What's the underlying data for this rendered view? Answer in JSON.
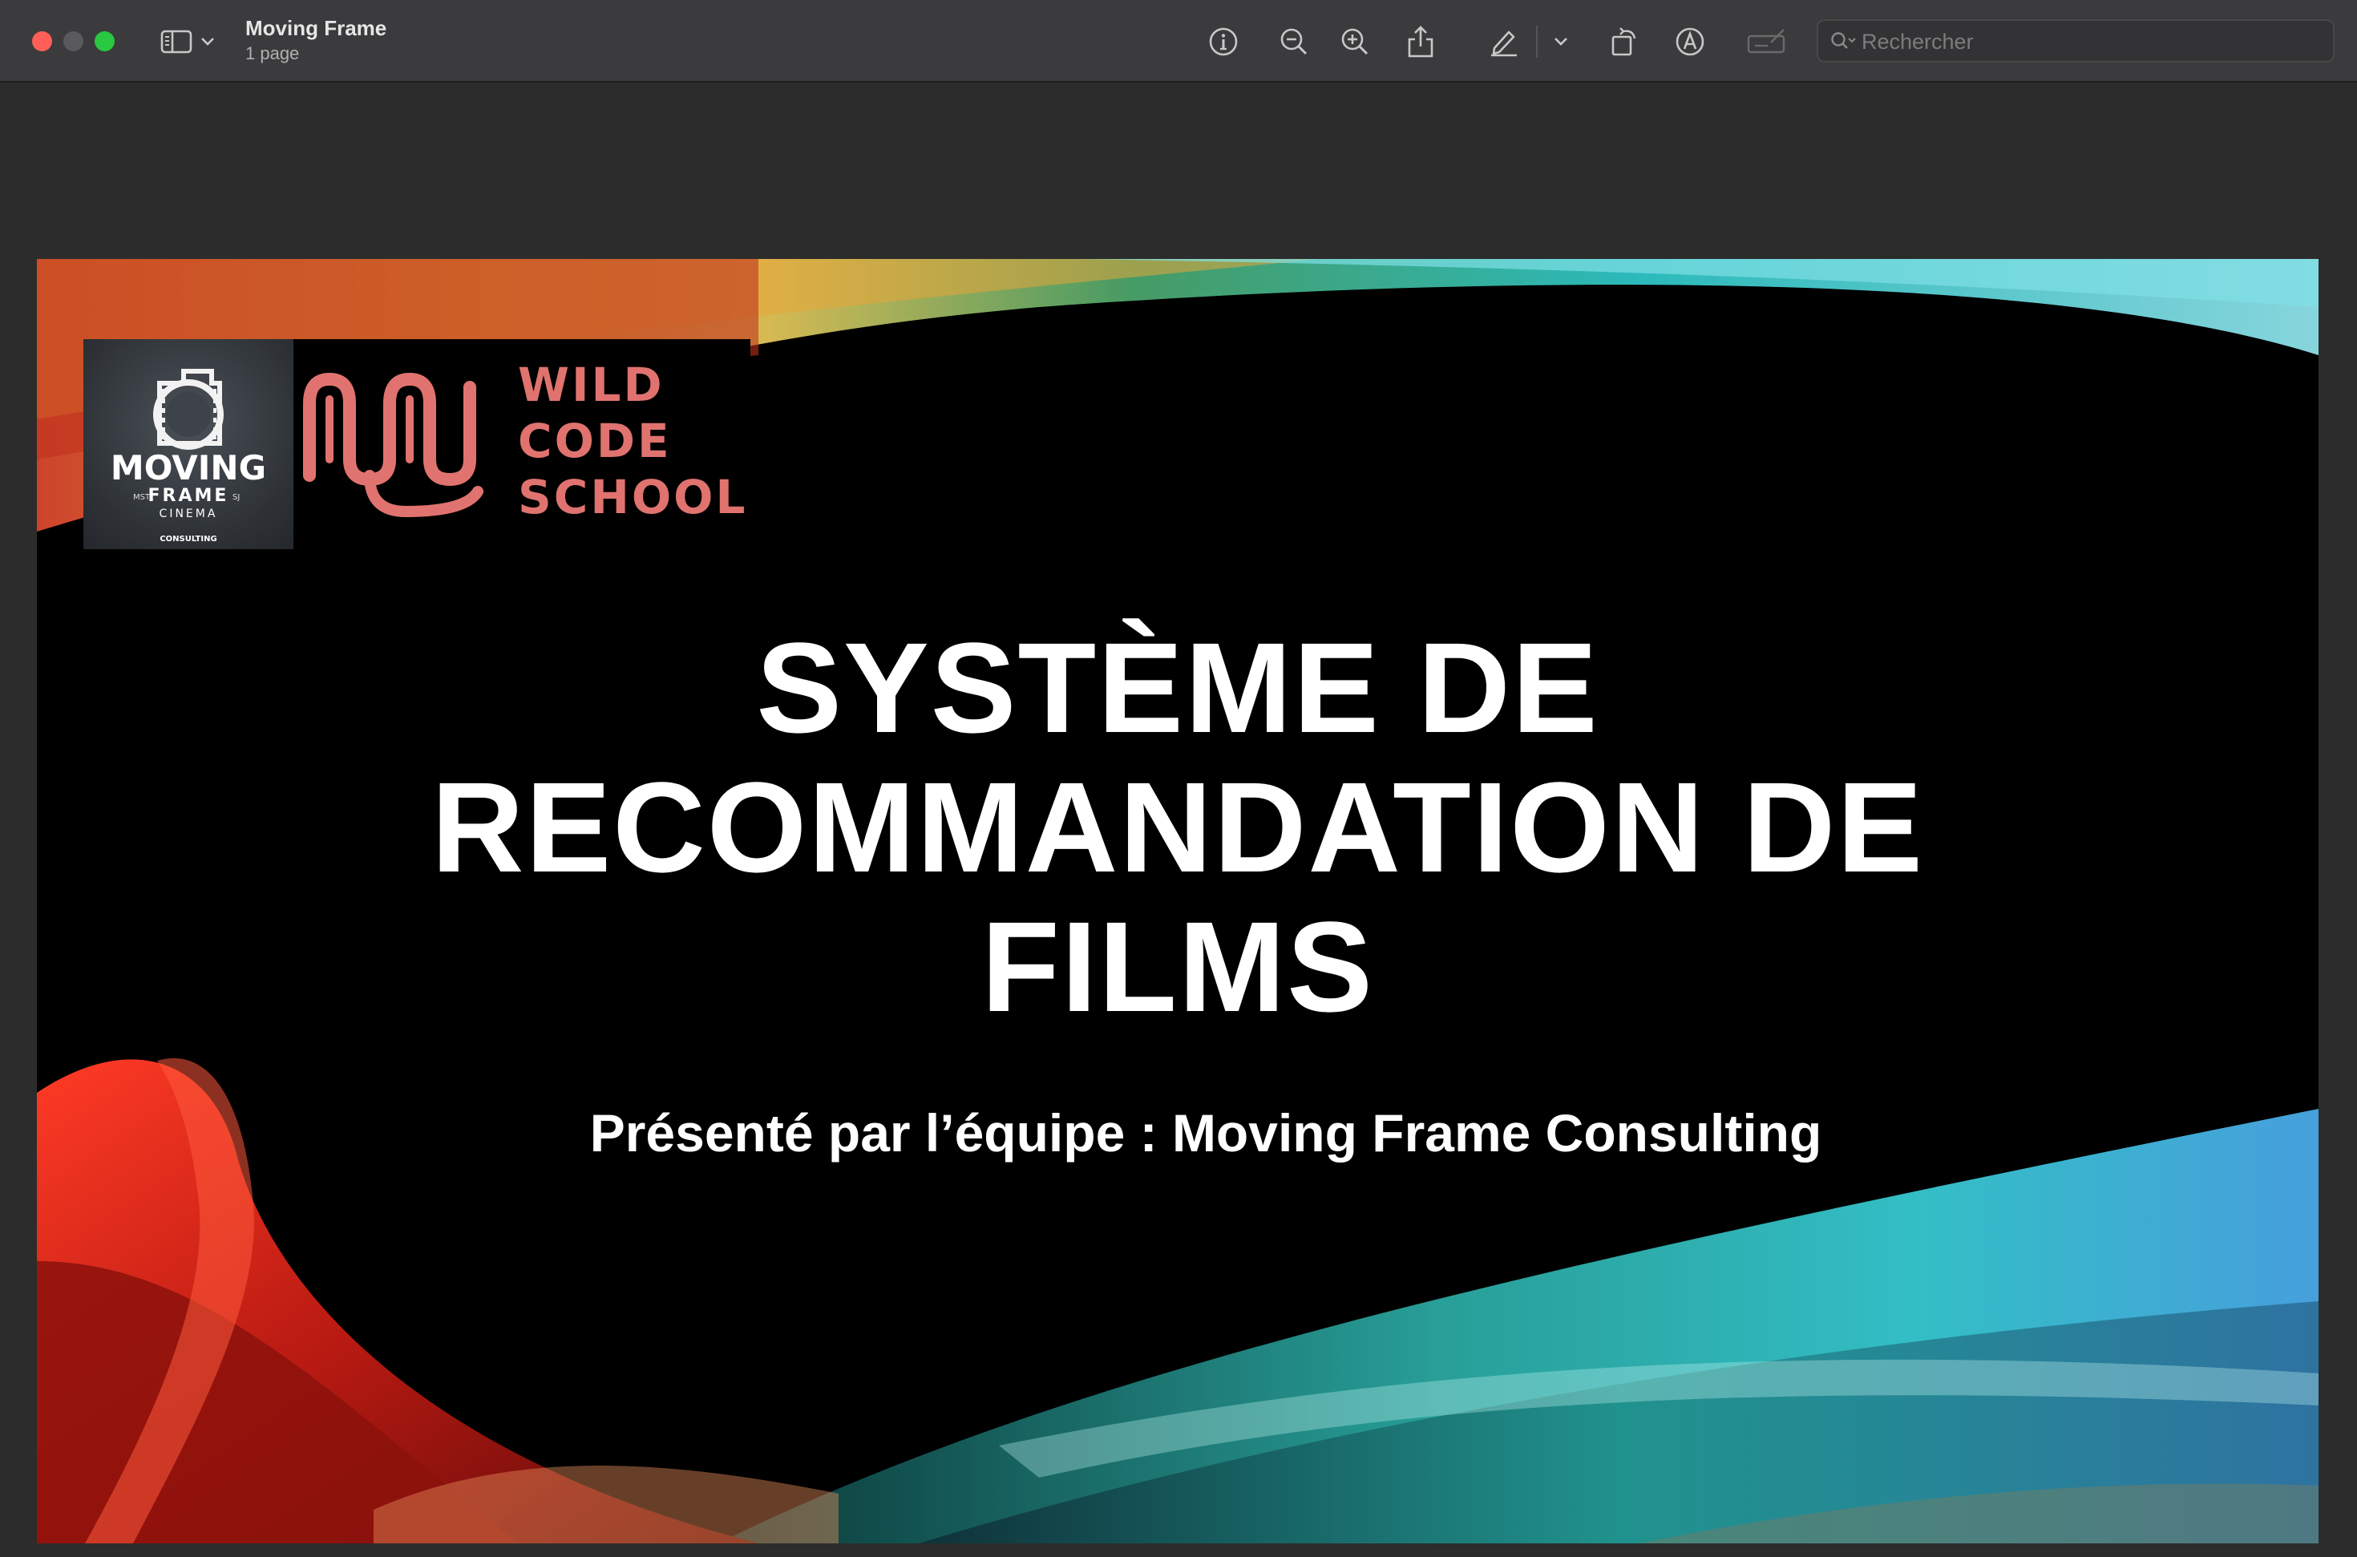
{
  "window": {
    "title": "Moving Frame",
    "page_count": "1 page"
  },
  "toolbar": {
    "icons": [
      "sidebar-icon",
      "chevron-down-icon",
      "info-icon",
      "zoom-out-icon",
      "zoom-in-icon",
      "share-icon",
      "highlight-pen-icon",
      "chevron-down-icon",
      "rotate-icon",
      "markup-icon",
      "form-fill-icon",
      "search-icon"
    ],
    "search_placeholder": "Rechercher"
  },
  "slide": {
    "logo_moving_frame": {
      "main": "MOVING",
      "frame": "FRAME",
      "mst": "MST",
      "sj": "SJ",
      "cinema": "CINEMA",
      "consulting": "CONSULTING"
    },
    "logo_wild_code_school": [
      "WILD",
      "CODE",
      "SCHOOL"
    ],
    "title_lines": [
      "SYSTÈME DE",
      "RECOMMANDATION DE",
      "FILMS"
    ],
    "subtitle": "Présenté par l’équipe : Moving Frame Consulting"
  },
  "colors": {
    "toolbar_bg": "#3b3b3d",
    "canvas_bg": "#2c2c2c",
    "close": "#ff5f57",
    "minimize": "#5a5a5c",
    "maximize": "#28c840",
    "wcs_brand": "#e0736f"
  }
}
